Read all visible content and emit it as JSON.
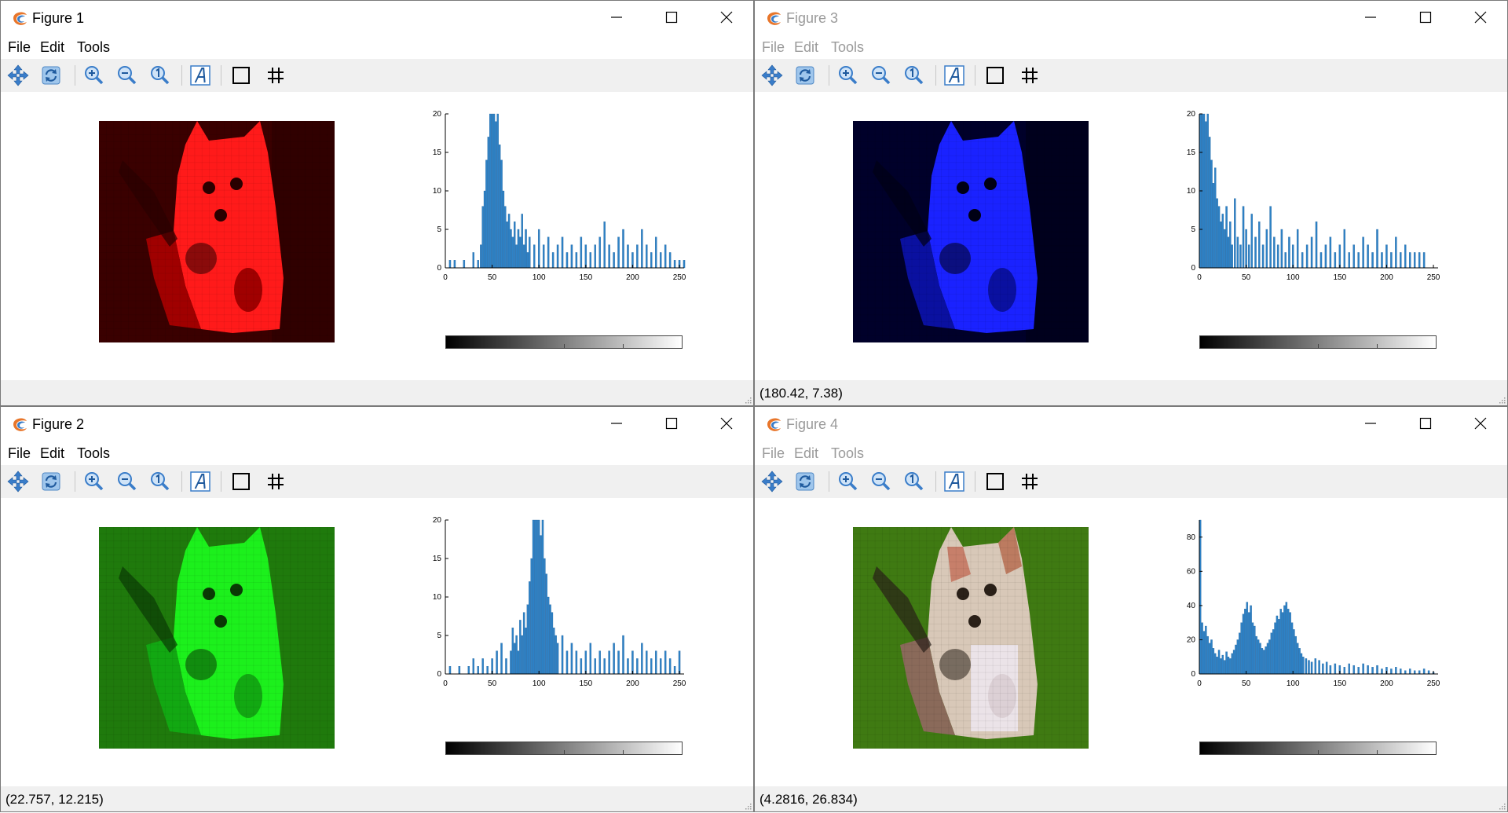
{
  "menu": {
    "file": "File",
    "edit": "Edit",
    "tools": "Tools"
  },
  "toolbar_icons": [
    "pan-icon",
    "rotate-icon",
    "zoom-in-icon",
    "zoom-out-icon",
    "zoom-reset-icon",
    "text-icon",
    "axes-box-icon",
    "grid-icon"
  ],
  "colors": {
    "hist_bar": "#2e82c6",
    "status_bg": "#f0f0f0",
    "toolbar_bg": "#f0f0f0"
  },
  "figures": [
    {
      "id": "fig1",
      "title": "Figure 1",
      "active": true,
      "status": "",
      "image_channel": "red",
      "chart_data": {
        "type": "bar",
        "xlim": [
          0,
          255
        ],
        "ylim": [
          0,
          20
        ],
        "xticks": [
          0,
          50,
          100,
          150,
          200,
          250
        ],
        "yticks": [
          0,
          5,
          10,
          15,
          20
        ],
        "colorbar": "grayscale 0-255",
        "bins": [
          [
            5,
            1
          ],
          [
            10,
            1
          ],
          [
            20,
            1
          ],
          [
            30,
            2
          ],
          [
            35,
            1
          ],
          [
            38,
            3
          ],
          [
            40,
            8
          ],
          [
            42,
            10
          ],
          [
            44,
            14
          ],
          [
            46,
            17
          ],
          [
            48,
            20
          ],
          [
            50,
            20
          ],
          [
            52,
            20
          ],
          [
            54,
            19
          ],
          [
            56,
            20
          ],
          [
            58,
            16
          ],
          [
            60,
            14
          ],
          [
            62,
            10
          ],
          [
            64,
            8
          ],
          [
            66,
            6
          ],
          [
            68,
            7
          ],
          [
            70,
            5
          ],
          [
            72,
            4
          ],
          [
            74,
            6
          ],
          [
            76,
            3
          ],
          [
            78,
            5
          ],
          [
            80,
            4
          ],
          [
            82,
            7
          ],
          [
            84,
            3
          ],
          [
            86,
            5
          ],
          [
            88,
            2
          ],
          [
            90,
            4
          ],
          [
            95,
            3
          ],
          [
            100,
            5
          ],
          [
            105,
            3
          ],
          [
            110,
            4
          ],
          [
            115,
            2
          ],
          [
            120,
            3
          ],
          [
            125,
            4
          ],
          [
            130,
            2
          ],
          [
            135,
            3
          ],
          [
            140,
            2
          ],
          [
            145,
            4
          ],
          [
            150,
            3
          ],
          [
            155,
            2
          ],
          [
            160,
            3
          ],
          [
            165,
            4
          ],
          [
            170,
            6
          ],
          [
            175,
            3
          ],
          [
            180,
            2
          ],
          [
            185,
            4
          ],
          [
            190,
            5
          ],
          [
            195,
            3
          ],
          [
            200,
            2
          ],
          [
            205,
            3
          ],
          [
            210,
            5
          ],
          [
            215,
            3
          ],
          [
            220,
            2
          ],
          [
            225,
            4
          ],
          [
            230,
            2
          ],
          [
            235,
            3
          ],
          [
            240,
            2
          ],
          [
            245,
            1
          ],
          [
            250,
            1
          ],
          [
            255,
            1
          ]
        ]
      }
    },
    {
      "id": "fig3",
      "title": "Figure 3",
      "active": false,
      "status": "(180.42, 7.38)",
      "image_channel": "blue",
      "chart_data": {
        "type": "bar",
        "xlim": [
          0,
          255
        ],
        "ylim": [
          0,
          20
        ],
        "xticks": [
          0,
          50,
          100,
          150,
          200,
          250
        ],
        "yticks": [
          0,
          5,
          10,
          15,
          20
        ],
        "colorbar": "grayscale 0-255",
        "bins": [
          [
            1,
            20
          ],
          [
            3,
            20
          ],
          [
            5,
            20
          ],
          [
            7,
            19
          ],
          [
            9,
            20
          ],
          [
            11,
            17
          ],
          [
            13,
            14
          ],
          [
            15,
            11
          ],
          [
            17,
            13
          ],
          [
            19,
            9
          ],
          [
            21,
            8
          ],
          [
            23,
            6
          ],
          [
            25,
            7
          ],
          [
            27,
            5
          ],
          [
            29,
            8
          ],
          [
            31,
            4
          ],
          [
            33,
            6
          ],
          [
            35,
            3
          ],
          [
            38,
            9
          ],
          [
            41,
            4
          ],
          [
            44,
            3
          ],
          [
            47,
            8
          ],
          [
            50,
            5
          ],
          [
            53,
            3
          ],
          [
            56,
            7
          ],
          [
            60,
            4
          ],
          [
            64,
            6
          ],
          [
            68,
            3
          ],
          [
            72,
            5
          ],
          [
            76,
            8
          ],
          [
            80,
            4
          ],
          [
            84,
            3
          ],
          [
            88,
            5
          ],
          [
            92,
            2
          ],
          [
            96,
            4
          ],
          [
            100,
            3
          ],
          [
            105,
            5
          ],
          [
            110,
            2
          ],
          [
            115,
            3
          ],
          [
            120,
            4
          ],
          [
            125,
            6
          ],
          [
            130,
            2
          ],
          [
            135,
            3
          ],
          [
            140,
            4
          ],
          [
            145,
            2
          ],
          [
            150,
            3
          ],
          [
            155,
            5
          ],
          [
            160,
            2
          ],
          [
            165,
            3
          ],
          [
            170,
            2
          ],
          [
            175,
            4
          ],
          [
            180,
            3
          ],
          [
            185,
            2
          ],
          [
            190,
            5
          ],
          [
            195,
            2
          ],
          [
            200,
            3
          ],
          [
            205,
            2
          ],
          [
            210,
            4
          ],
          [
            215,
            2
          ],
          [
            220,
            3
          ],
          [
            225,
            2
          ],
          [
            230,
            2
          ],
          [
            235,
            2
          ],
          [
            240,
            2
          ]
        ]
      }
    },
    {
      "id": "fig2",
      "title": "Figure 2",
      "active": true,
      "status": "(22.757, 12.215)",
      "image_channel": "green",
      "chart_data": {
        "type": "bar",
        "xlim": [
          0,
          255
        ],
        "ylim": [
          0,
          20
        ],
        "xticks": [
          0,
          50,
          100,
          150,
          200,
          250
        ],
        "yticks": [
          0,
          5,
          10,
          15,
          20
        ],
        "colorbar": "grayscale 0-255",
        "bins": [
          [
            5,
            1
          ],
          [
            15,
            1
          ],
          [
            25,
            1
          ],
          [
            30,
            2
          ],
          [
            35,
            1
          ],
          [
            40,
            2
          ],
          [
            45,
            1
          ],
          [
            50,
            2
          ],
          [
            55,
            3
          ],
          [
            60,
            4
          ],
          [
            65,
            2
          ],
          [
            70,
            3
          ],
          [
            72,
            6
          ],
          [
            74,
            4
          ],
          [
            76,
            5
          ],
          [
            78,
            3
          ],
          [
            80,
            7
          ],
          [
            82,
            5
          ],
          [
            84,
            8
          ],
          [
            86,
            6
          ],
          [
            88,
            9
          ],
          [
            90,
            12
          ],
          [
            92,
            15
          ],
          [
            94,
            20
          ],
          [
            96,
            20
          ],
          [
            98,
            20
          ],
          [
            100,
            20
          ],
          [
            102,
            18
          ],
          [
            104,
            20
          ],
          [
            106,
            15
          ],
          [
            108,
            13
          ],
          [
            110,
            10
          ],
          [
            112,
            9
          ],
          [
            114,
            8
          ],
          [
            116,
            6
          ],
          [
            118,
            5
          ],
          [
            120,
            4
          ],
          [
            125,
            5
          ],
          [
            130,
            3
          ],
          [
            135,
            4
          ],
          [
            140,
            3
          ],
          [
            145,
            2
          ],
          [
            150,
            3
          ],
          [
            155,
            4
          ],
          [
            160,
            2
          ],
          [
            165,
            3
          ],
          [
            170,
            2
          ],
          [
            175,
            3
          ],
          [
            180,
            4
          ],
          [
            185,
            3
          ],
          [
            190,
            5
          ],
          [
            195,
            2
          ],
          [
            200,
            3
          ],
          [
            205,
            2
          ],
          [
            210,
            4
          ],
          [
            215,
            3
          ],
          [
            220,
            2
          ],
          [
            225,
            3
          ],
          [
            230,
            2
          ],
          [
            235,
            3
          ],
          [
            240,
            2
          ],
          [
            245,
            1
          ],
          [
            250,
            3
          ]
        ]
      }
    },
    {
      "id": "fig4",
      "title": "Figure 4",
      "active": false,
      "status": "(4.2816, 26.834)",
      "image_channel": "rgb",
      "chart_data": {
        "type": "bar",
        "xlim": [
          0,
          255
        ],
        "ylim": [
          0,
          90
        ],
        "xticks": [
          0,
          50,
          100,
          150,
          200,
          250
        ],
        "yticks": [
          0,
          20,
          40,
          60,
          80
        ],
        "colorbar": "grayscale 0-255",
        "bins": [
          [
            1,
            90
          ],
          [
            3,
            30
          ],
          [
            5,
            25
          ],
          [
            7,
            28
          ],
          [
            9,
            22
          ],
          [
            11,
            18
          ],
          [
            13,
            20
          ],
          [
            15,
            15
          ],
          [
            17,
            12
          ],
          [
            19,
            10
          ],
          [
            21,
            14
          ],
          [
            23,
            9
          ],
          [
            25,
            11
          ],
          [
            27,
            8
          ],
          [
            29,
            13
          ],
          [
            31,
            10
          ],
          [
            33,
            9
          ],
          [
            35,
            12
          ],
          [
            37,
            14
          ],
          [
            39,
            17
          ],
          [
            41,
            20
          ],
          [
            43,
            24
          ],
          [
            45,
            30
          ],
          [
            47,
            35
          ],
          [
            49,
            38
          ],
          [
            51,
            42
          ],
          [
            53,
            36
          ],
          [
            55,
            40
          ],
          [
            57,
            30
          ],
          [
            59,
            28
          ],
          [
            61,
            22
          ],
          [
            63,
            20
          ],
          [
            65,
            18
          ],
          [
            67,
            15
          ],
          [
            69,
            14
          ],
          [
            71,
            16
          ],
          [
            73,
            18
          ],
          [
            75,
            20
          ],
          [
            77,
            24
          ],
          [
            79,
            26
          ],
          [
            81,
            30
          ],
          [
            83,
            34
          ],
          [
            85,
            32
          ],
          [
            87,
            38
          ],
          [
            89,
            36
          ],
          [
            91,
            40
          ],
          [
            93,
            42
          ],
          [
            95,
            38
          ],
          [
            97,
            36
          ],
          [
            99,
            30
          ],
          [
            101,
            26
          ],
          [
            103,
            22
          ],
          [
            105,
            18
          ],
          [
            107,
            15
          ],
          [
            109,
            12
          ],
          [
            111,
            10
          ],
          [
            114,
            9
          ],
          [
            117,
            8
          ],
          [
            120,
            7
          ],
          [
            124,
            9
          ],
          [
            128,
            8
          ],
          [
            132,
            6
          ],
          [
            136,
            7
          ],
          [
            140,
            5
          ],
          [
            145,
            6
          ],
          [
            150,
            5
          ],
          [
            155,
            4
          ],
          [
            160,
            6
          ],
          [
            165,
            5
          ],
          [
            170,
            4
          ],
          [
            175,
            6
          ],
          [
            180,
            5
          ],
          [
            185,
            4
          ],
          [
            190,
            5
          ],
          [
            195,
            3
          ],
          [
            200,
            4
          ],
          [
            205,
            3
          ],
          [
            210,
            4
          ],
          [
            215,
            3
          ],
          [
            220,
            2
          ],
          [
            225,
            3
          ],
          [
            230,
            2
          ],
          [
            235,
            2
          ],
          [
            240,
            3
          ],
          [
            245,
            2
          ],
          [
            250,
            1
          ]
        ]
      }
    }
  ]
}
